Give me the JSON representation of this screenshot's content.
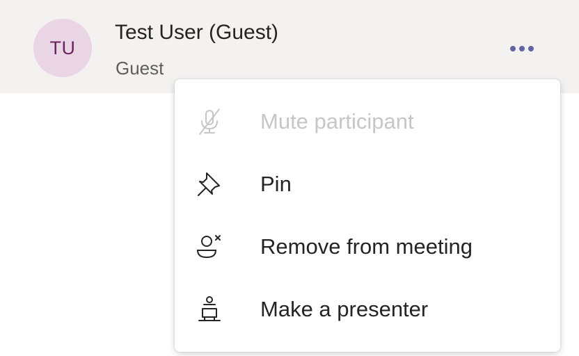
{
  "participant": {
    "initials": "TU",
    "name": "Test User (Guest)",
    "role": "Guest",
    "avatar_bg": "#ead5e5",
    "avatar_fg": "#6b2460",
    "more_icon": "more-options-icon"
  },
  "menu": {
    "items": [
      {
        "label": "Mute participant",
        "icon": "mic-off-icon",
        "disabled": true
      },
      {
        "label": "Pin",
        "icon": "pin-icon",
        "disabled": false
      },
      {
        "label": "Remove from meeting",
        "icon": "remove-person-icon",
        "disabled": false
      },
      {
        "label": "Make a presenter",
        "icon": "presenter-icon",
        "disabled": false
      }
    ]
  },
  "colors": {
    "accent": "#6264a7",
    "row_background": "#f3f2f1",
    "disabled_text": "#c8c6c4",
    "text": "#252423"
  }
}
